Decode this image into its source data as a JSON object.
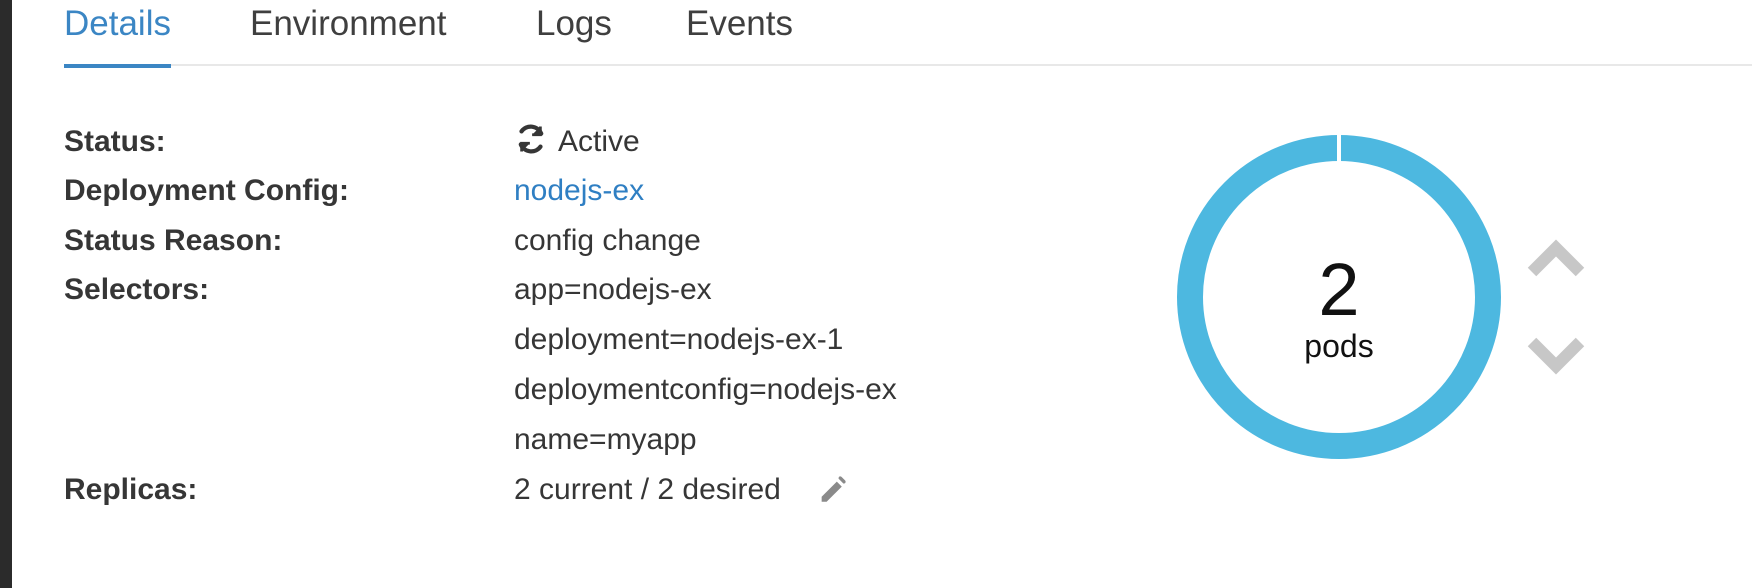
{
  "tabs": [
    {
      "label": "Details",
      "active": true
    },
    {
      "label": "Environment",
      "active": false
    },
    {
      "label": "Logs",
      "active": false
    },
    {
      "label": "Events",
      "active": false
    }
  ],
  "details": {
    "status": {
      "label": "Status:",
      "value": "Active",
      "icon": "refresh-icon"
    },
    "deployment_config": {
      "label": "Deployment Config:",
      "value": "nodejs-ex"
    },
    "status_reason": {
      "label": "Status Reason:",
      "value": "config change"
    },
    "selectors": {
      "label": "Selectors:",
      "values": [
        "app=nodejs-ex",
        "deployment=nodejs-ex-1",
        "deploymentconfig=nodejs-ex",
        "name=myapp"
      ]
    },
    "replicas": {
      "label": "Replicas:",
      "value": "2 current / 2 desired",
      "edit_icon": "pencil-icon"
    }
  },
  "pods": {
    "count": "2",
    "unit": "pods",
    "ring_color": "#4db8e0",
    "scale_up_icon": "chevron-up-icon",
    "scale_down_icon": "chevron-down-icon",
    "control_color": "#c7c7c7"
  },
  "colors": {
    "accent": "#3b86c4",
    "link": "#2f7fc3",
    "text": "#363636"
  }
}
